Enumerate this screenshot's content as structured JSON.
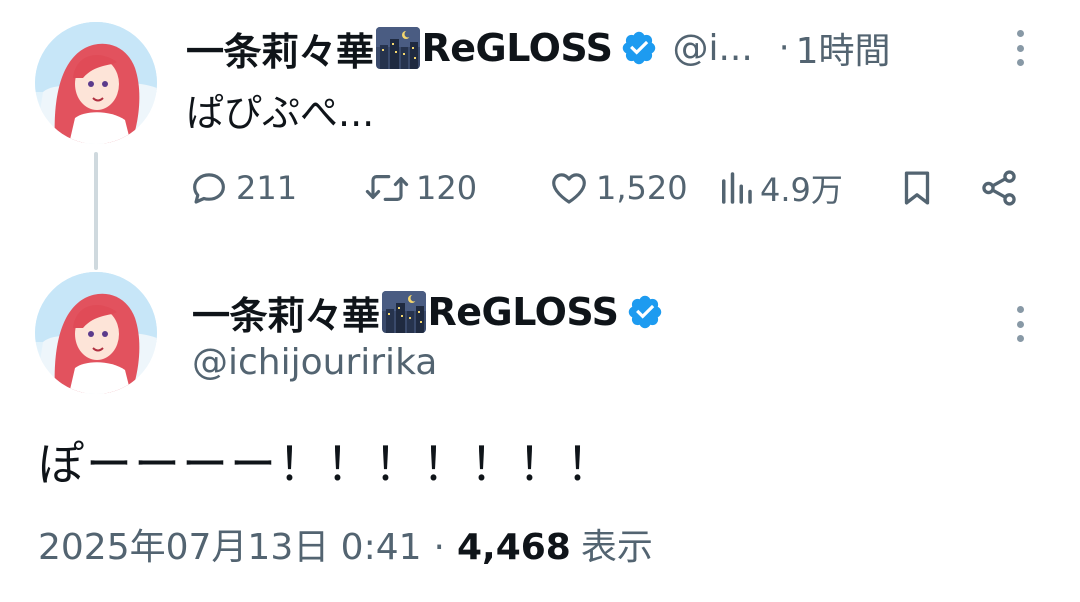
{
  "colors": {
    "text_primary": "#0f1419",
    "text_secondary": "#536471",
    "verified_blue": "#1d9bf0",
    "thread_line": "#cfd9de"
  },
  "reply_tweet": {
    "author": {
      "display_name": "一条莉々華",
      "name_suffix": "ReGLOSS",
      "emoji": "night-city-emoji",
      "verified": true,
      "handle": "@i..."
    },
    "separator": "·",
    "time_ago": "1時間",
    "text": "ぱぴぷぺ...",
    "actions": {
      "replies": "211",
      "retweets": "120",
      "likes": "1,520",
      "views": "4.9万"
    }
  },
  "main_tweet": {
    "author": {
      "display_name": "一条莉々華",
      "name_suffix": "ReGLOSS",
      "emoji": "night-city-emoji",
      "verified": true,
      "handle": "@ichijouririka"
    },
    "text": "ぽーーーー！！！！！！！",
    "timestamp": "2025年07月13日 0:41",
    "separator": "·",
    "view_count": "4,468",
    "view_label": "表示"
  }
}
